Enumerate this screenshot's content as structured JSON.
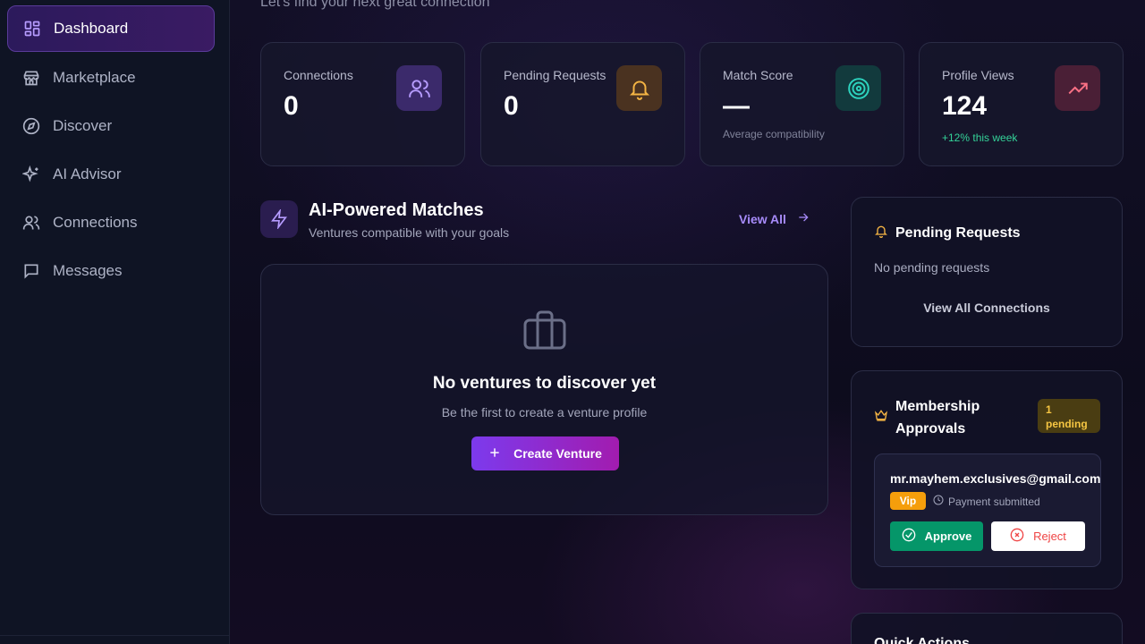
{
  "sidebar": {
    "items": [
      {
        "label": "Dashboard",
        "icon": "dashboard-grid-icon",
        "active": true
      },
      {
        "label": "Marketplace",
        "icon": "store-icon"
      },
      {
        "label": "Discover",
        "icon": "compass-icon"
      },
      {
        "label": "AI Advisor",
        "icon": "sparkles-icon"
      },
      {
        "label": "Connections",
        "icon": "users-icon"
      },
      {
        "label": "Messages",
        "icon": "message-icon"
      }
    ]
  },
  "header": {
    "greeting": "Let's find your next great connection"
  },
  "stats": [
    {
      "label": "Connections",
      "value": "0",
      "icon": "users-icon",
      "color": "#a78bfa"
    },
    {
      "label": "Pending Requests",
      "value": "0",
      "icon": "bell-icon",
      "color": "#f5b544"
    },
    {
      "label": "Match Score",
      "value": "—",
      "sub": "Average compatibility",
      "icon": "target-icon",
      "color": "#2dd4bf"
    },
    {
      "label": "Profile Views",
      "value": "124",
      "sub": "+12% this week",
      "icon": "trending-up-icon",
      "color": "#fb7185"
    }
  ],
  "matches": {
    "title": "AI-Powered Matches",
    "subtitle": "Ventures compatible with your goals",
    "view_all": "View All",
    "empty_title": "No ventures to discover yet",
    "empty_sub": "Be the first to create a venture profile",
    "create_label": "Create Venture"
  },
  "pending_panel": {
    "title": "Pending Requests",
    "empty": "No pending requests",
    "view_all": "View All Connections"
  },
  "membership": {
    "title": "Membership Approvals",
    "badge_count": "1",
    "badge_label": "pending",
    "request": {
      "email": "mr.mayhem.exclusives@gmail.com",
      "tier": "Vip",
      "status": "Payment submitted",
      "approve_label": "Approve",
      "reject_label": "Reject"
    }
  },
  "quick_actions": {
    "title": "Quick Actions"
  },
  "colors": {
    "accent": "#7c3aed",
    "approve": "#059669",
    "reject": "#ef4444",
    "vip": "#f59e0b"
  }
}
